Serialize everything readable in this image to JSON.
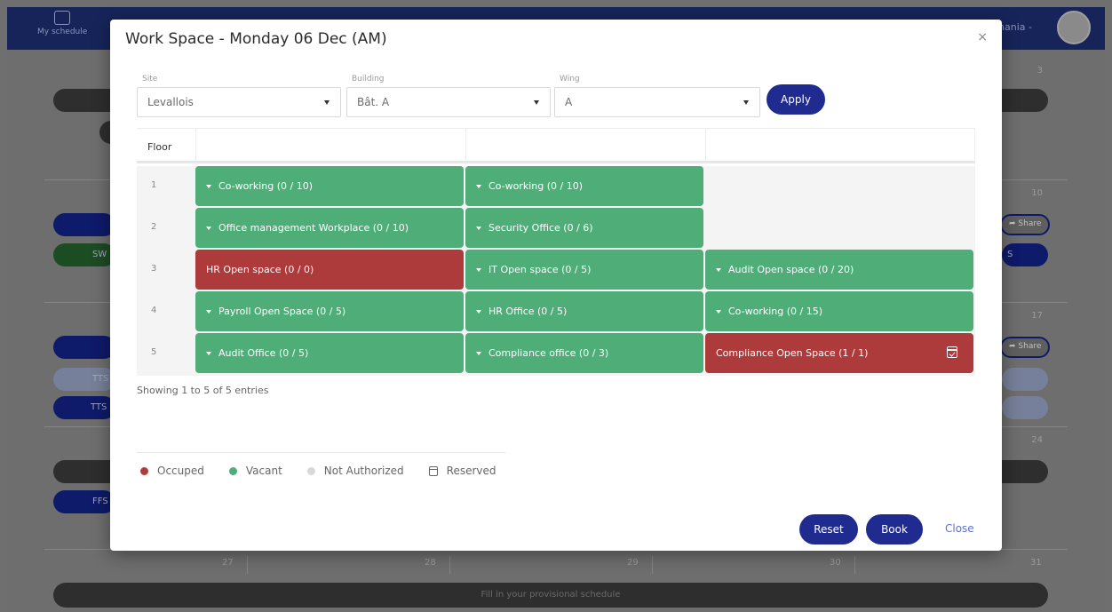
{
  "background": {
    "nav_label": "My schedule",
    "user_name": "nania -",
    "day_numbers": [
      "3",
      "10",
      "17",
      "24"
    ],
    "share_label": "Share",
    "row_labels": [
      "SW",
      "TTS",
      "TTS",
      "FFS",
      "S"
    ],
    "bottom_days": [
      "27",
      "28",
      "29",
      "30",
      "31"
    ],
    "fill_schedule": "Fill in your provisional schedule"
  },
  "modal": {
    "title": "Work Space - Monday 06 Dec (AM)",
    "close_symbol": "×",
    "filters": {
      "site_label": "Site",
      "site_value": "Levallois",
      "building_label": "Building",
      "building_value": "Bât. A",
      "wing_label": "Wing",
      "wing_value": "A",
      "apply_label": "Apply"
    },
    "table": {
      "floor_header": "Floor",
      "rows": [
        {
          "floor": "1",
          "cells": [
            {
              "label": "Co-working (0 / 10)",
              "status": "vacant",
              "expandable": true
            },
            {
              "label": "Co-working (0 / 10)",
              "status": "vacant",
              "expandable": true
            },
            null
          ]
        },
        {
          "floor": "2",
          "cells": [
            {
              "label": "Office management Workplace (0 / 10)",
              "status": "vacant",
              "expandable": true
            },
            {
              "label": "Security Office (0 / 6)",
              "status": "vacant",
              "expandable": true
            },
            null
          ]
        },
        {
          "floor": "3",
          "cells": [
            {
              "label": "HR Open space (0 / 0)",
              "status": "occupied",
              "expandable": false
            },
            {
              "label": "IT Open space (0 / 5)",
              "status": "vacant",
              "expandable": true
            },
            {
              "label": "Audit Open space (0 / 20)",
              "status": "vacant",
              "expandable": true
            }
          ]
        },
        {
          "floor": "4",
          "cells": [
            {
              "label": "Payroll Open Space (0 / 5)",
              "status": "vacant",
              "expandable": true
            },
            {
              "label": "HR Office (0 / 5)",
              "status": "vacant",
              "expandable": true
            },
            {
              "label": "Co-working (0 / 15)",
              "status": "vacant",
              "expandable": true
            }
          ]
        },
        {
          "floor": "5",
          "cells": [
            {
              "label": "Audit Office (0 / 5)",
              "status": "vacant",
              "expandable": true
            },
            {
              "label": "Compliance office (0 / 3)",
              "status": "vacant",
              "expandable": true
            },
            {
              "label": "Compliance Open Space (1 / 1)",
              "status": "occupied",
              "expandable": false,
              "reserved": true
            }
          ]
        }
      ]
    },
    "entries_text": "Showing 1 to 5 of 5 entries",
    "legend": {
      "occupied": "Occuped",
      "vacant": "Vacant",
      "not_authorized": "Not Authorized",
      "reserved": "Reserved"
    },
    "buttons": {
      "reset": "Reset",
      "book": "Book",
      "close": "Close"
    }
  },
  "colors": {
    "vacant": "#4fae78",
    "occupied": "#ad3b3b",
    "not_authorized": "#d8d8d8",
    "primary": "#1f2b8f",
    "link": "#5a72d6",
    "nav": "#16245a"
  },
  "icons": [
    "calendar-icon",
    "chart-icon",
    "settings-icon",
    "caret-down-icon",
    "calendar-check-icon",
    "close-icon"
  ]
}
